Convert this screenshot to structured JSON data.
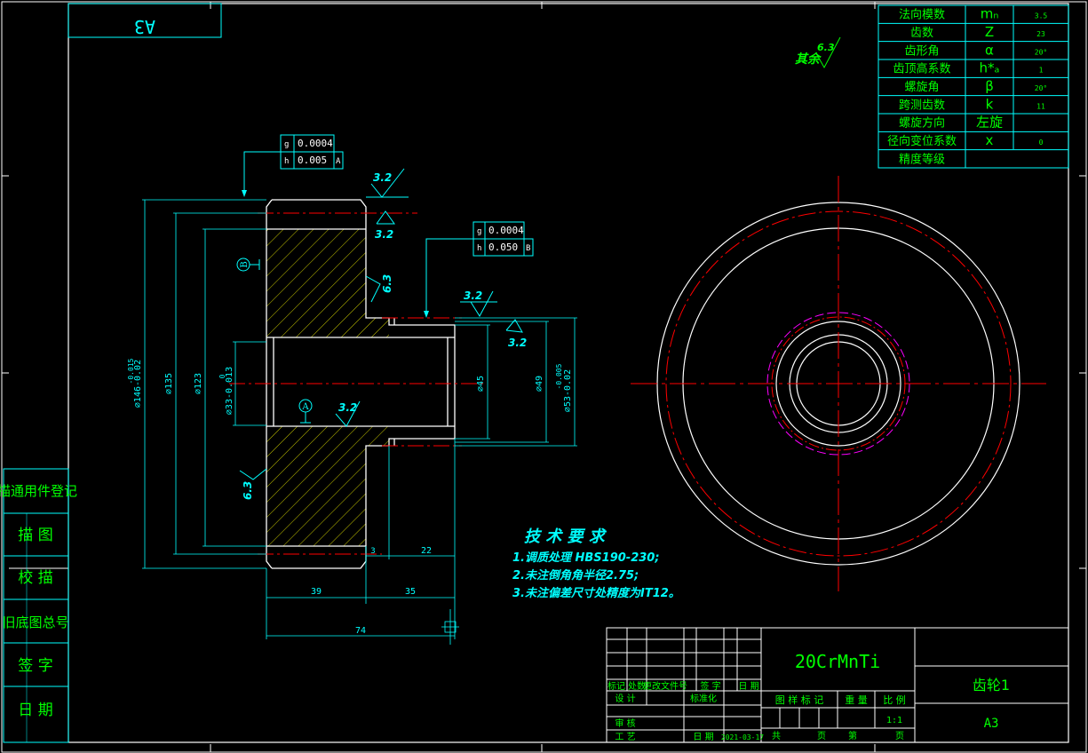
{
  "colors": {
    "background": "#000000",
    "frame": "#ffffff",
    "table_lines": "#00ffff",
    "text": "#00ff00",
    "dimension": "#00ffff",
    "center_line": "#ff0000",
    "hatch": "#ffff00",
    "pitch_circle": "#ff00ff",
    "note": "#00ffff"
  },
  "format_label_mirrored": "A3",
  "params": {
    "rows": [
      {
        "name": "法向模数",
        "symbol": "mₙ",
        "value": "3.5"
      },
      {
        "name": "齿数",
        "symbol": "Z",
        "value": "23"
      },
      {
        "name": "齿形角",
        "symbol": "α",
        "value": "20°"
      },
      {
        "name": "齿顶高系数",
        "symbol": "h*ₐ",
        "value": "1"
      },
      {
        "name": "螺旋角",
        "symbol": "β",
        "value": "20°"
      },
      {
        "name": "跨测齿数",
        "symbol": "k",
        "value": "11"
      },
      {
        "name": "螺旋方向",
        "symbol": "左旋",
        "value": ""
      },
      {
        "name": "径向变位系数",
        "symbol": "x",
        "value": "0"
      },
      {
        "name": "精度等级",
        "symbol": "",
        "value": ""
      }
    ]
  },
  "roughness": {
    "other": "其余",
    "other_value": "6.3",
    "r1": "3.2",
    "r2": "3.2",
    "r3": "6.3",
    "r4": "3.2",
    "r5": "3.2",
    "r6": "3.2",
    "r7": "6.3"
  },
  "tolerance1": {
    "row1_sym": "g",
    "row1_val": "0.0004",
    "row2_sym": "h",
    "row2_val": "0.005",
    "row2_ref": "A"
  },
  "tolerance2": {
    "row1_sym": "g",
    "row1_val": "0.0004",
    "row2_sym": "h",
    "row2_val": "0.050",
    "row2_ref": "B"
  },
  "dimensions": {
    "d146": "⌀146-0.02",
    "d146_up": "-0.015",
    "d135": "⌀135",
    "d123": "⌀123",
    "d33": "⌀33-0.013",
    "d33_up": "0",
    "d45": "⌀45",
    "d49": "⌀49",
    "d53": "⌀53-0.02",
    "d53_up": "-0.005",
    "w39": "39",
    "w35": "35",
    "w74": "74",
    "w3": "3",
    "w22": "22"
  },
  "datum": {
    "a": "A",
    "b": "B"
  },
  "tech": {
    "title": "技 术 要 求",
    "items": [
      "1.调质处理 HBS190-230;",
      "2.未注倒角角半径2.75;",
      "3.未注偏差尺寸处精度为IT12。"
    ]
  },
  "side_labels": [
    "描通用件登记",
    "描 图",
    "校 描",
    "旧底图总号",
    "签 字",
    "日 期"
  ],
  "title_block": {
    "material": "20CrMnTi",
    "part_name": "齿轮1",
    "sheet_size": "A3",
    "rev_headers": [
      "标记",
      "处数",
      "更改文件号",
      "签 字",
      "日 期"
    ],
    "design": "设 计",
    "standard": "标准化",
    "review": "审 核",
    "process": "工 艺",
    "date": "日 期",
    "date_value": "2021-03-17",
    "mark_label": "图 样 标 记",
    "weight_label": "重 量",
    "scale_label": "比 例",
    "scale_value": "1:1",
    "total_label": "共",
    "page_label": "页",
    "sheet_label": "第",
    "page_label2": "页"
  }
}
